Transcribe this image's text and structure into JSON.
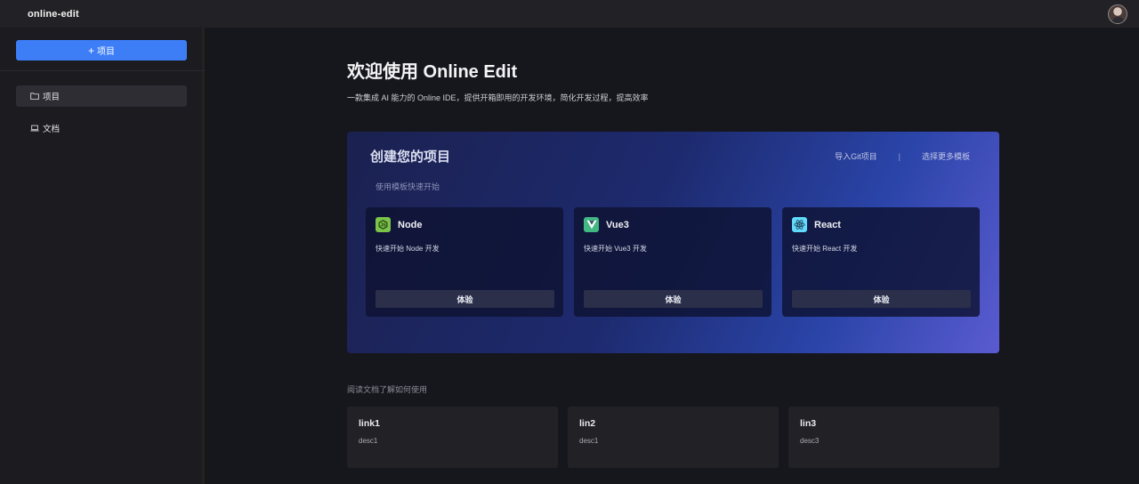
{
  "header": {
    "brand": "online-edit"
  },
  "sidebar": {
    "new_button_label": "项目",
    "items": [
      {
        "label": "项目",
        "icon": "folder-icon",
        "active": true
      },
      {
        "label": "文档",
        "icon": "laptop-icon",
        "active": false
      }
    ]
  },
  "main": {
    "title": "欢迎使用 Online Edit",
    "subtitle": "一款集成 AI 能力的 Online IDE，提供开箱即用的开发环境，简化开发过程，提高效率",
    "hero": {
      "title": "创建您的项目",
      "hint": "使用模板快速开始",
      "links": [
        "导入Git项目",
        "|",
        "选择更多模板"
      ],
      "templates": [
        {
          "name": "Node",
          "desc": "快速开始 Node 开发",
          "button": "体验",
          "icon": "node-icon",
          "color": "#7cc34a"
        },
        {
          "name": "Vue3",
          "desc": "快速开始 Vue3 开发",
          "button": "体验",
          "icon": "vue-icon",
          "color": "#42b883"
        },
        {
          "name": "React",
          "desc": "快速开始 React 开发",
          "button": "体验",
          "icon": "react-icon",
          "color": "#61dafb"
        }
      ]
    },
    "docs_hint": "阅读文档了解如何使用",
    "docs": [
      {
        "title": "link1",
        "desc": "desc1"
      },
      {
        "title": "lin2",
        "desc": "desc1"
      },
      {
        "title": "lin3",
        "desc": "desc3"
      }
    ]
  },
  "colors": {
    "accent": "#3d7ef7",
    "background": "#16161d",
    "sidebar": "#1b1b20"
  }
}
